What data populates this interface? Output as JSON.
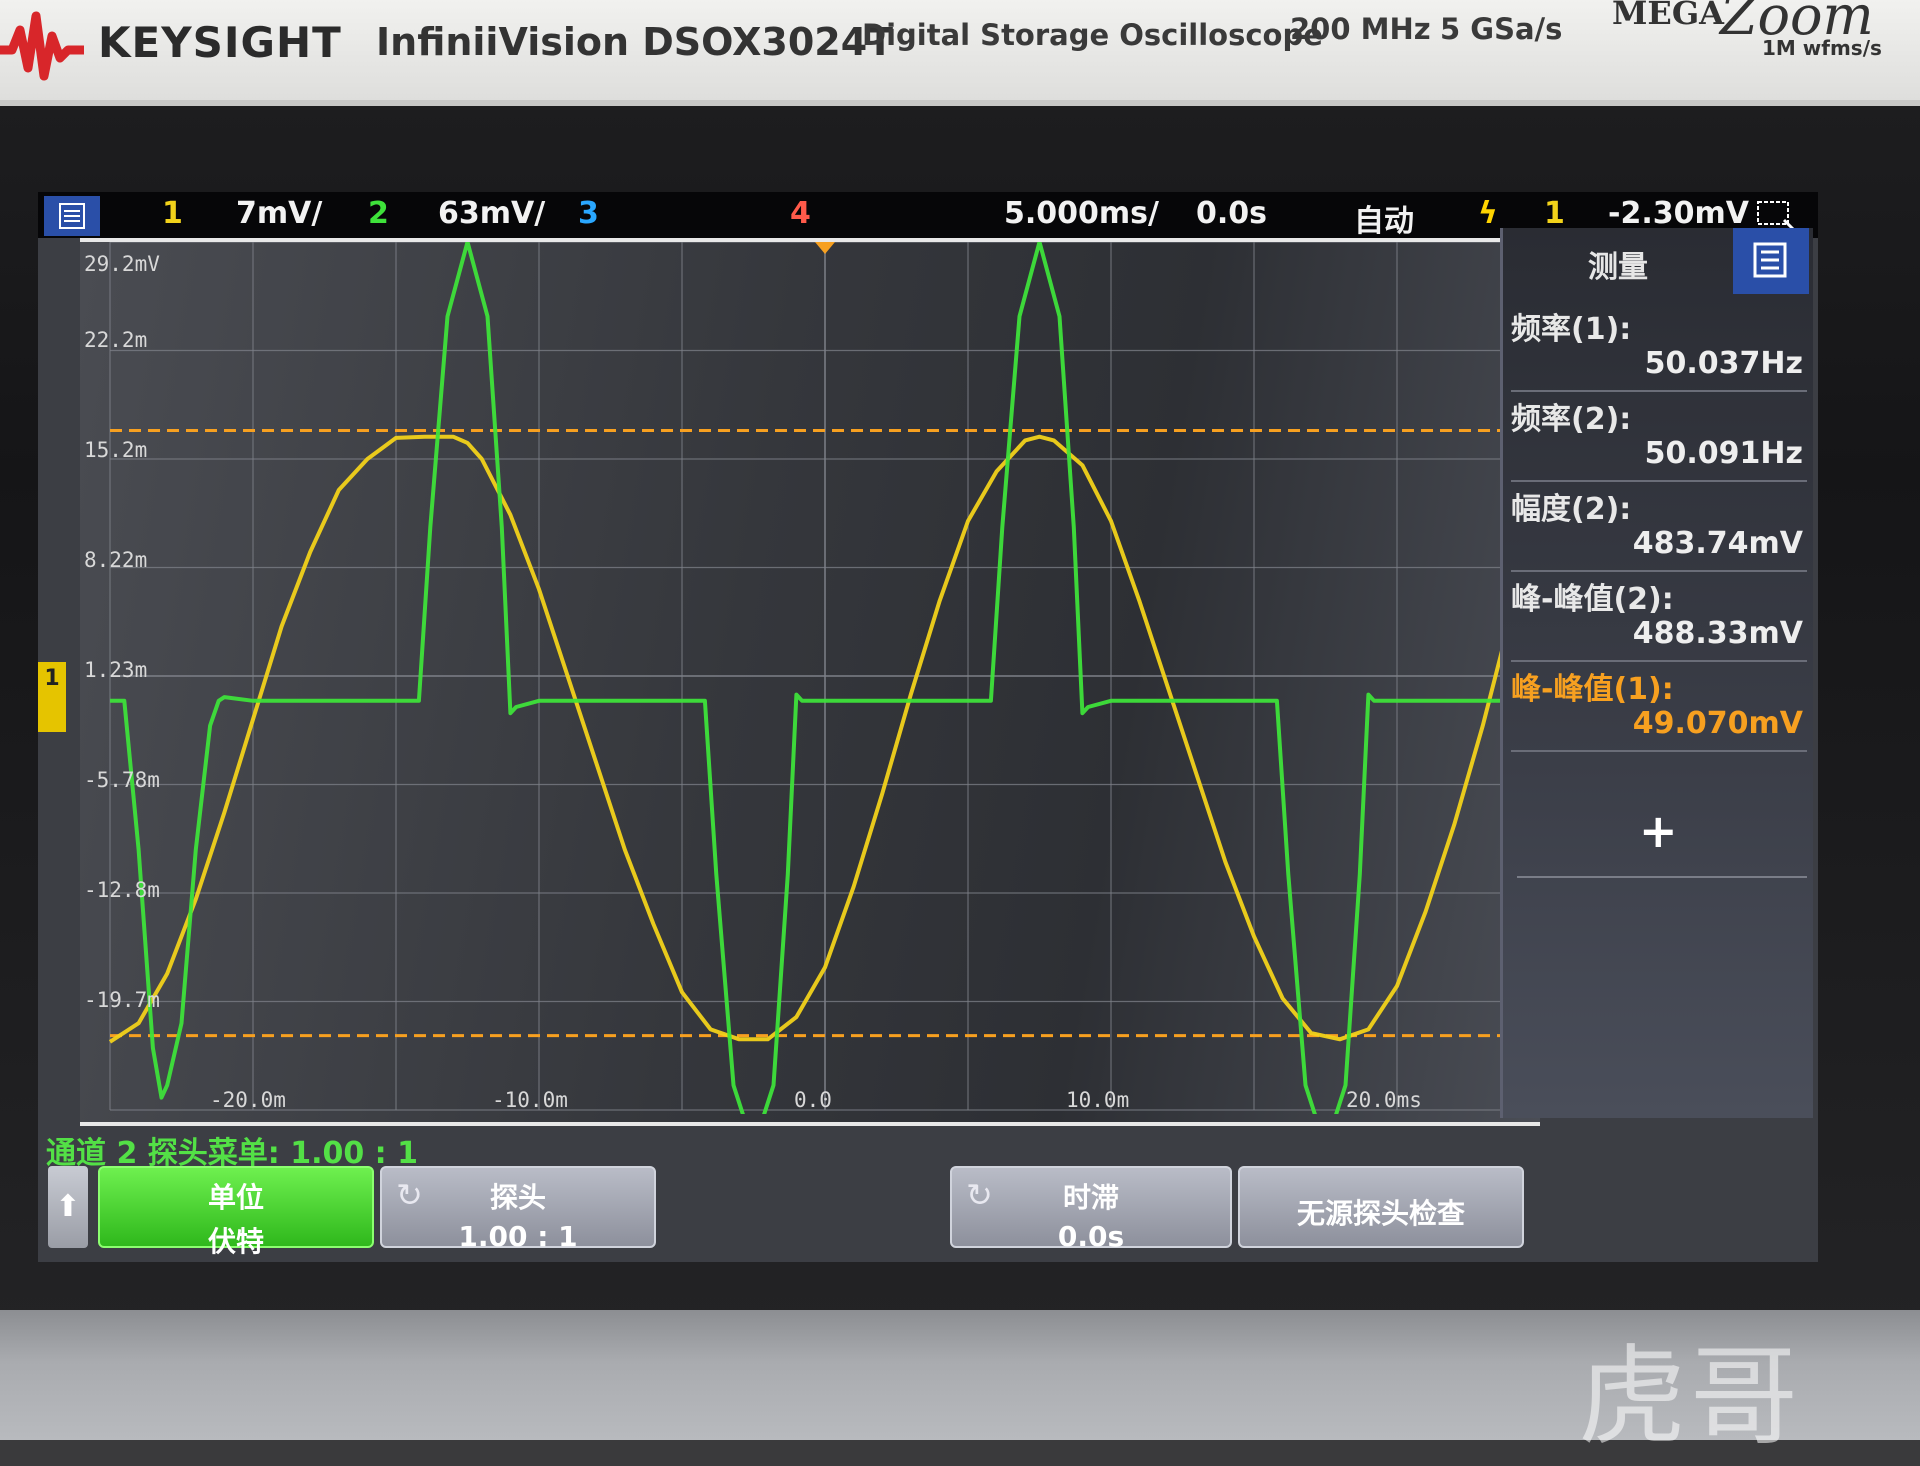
{
  "bezel": {
    "brand": "KEYSIGHT",
    "model": "InfiniiVision DSOX3024T",
    "description": "Digital Storage Oscilloscope",
    "bandwidth": "200 MHz",
    "sample_rate": "5 GSa/s",
    "megazoom_word": "MEGA",
    "megazoom_script": "Zoom",
    "megazoom_rate": "1M wfms/s",
    "watermark": "虎哥"
  },
  "status_bar": {
    "ch1_label": "1",
    "ch1_scale": "7mV/",
    "ch2_label": "2",
    "ch2_scale": "63mV/",
    "ch3_label": "3",
    "ch4_label": "4",
    "timebase": "5.000ms/",
    "delay": "0.0s",
    "trigger_mode": "自动",
    "trigger_source": "1",
    "trigger_level": "-2.30mV",
    "colors": {
      "ch1": "#f2d21a",
      "ch2": "#3ee23a",
      "ch3": "#2aa7ff",
      "ch4": "#ff5a4a",
      "trigger": "#ffd400"
    }
  },
  "measurements": {
    "title": "测量",
    "items": [
      {
        "label": "频率(1):",
        "value": "50.037Hz",
        "color": "#eeeeee"
      },
      {
        "label": "频率(2):",
        "value": "50.091Hz",
        "color": "#eeeeee"
      },
      {
        "label": "幅度(2):",
        "value": "483.74mV",
        "color": "#eeeeee"
      },
      {
        "label": "峰-峰值(2):",
        "value": "488.33mV",
        "color": "#eeeeee"
      },
      {
        "label": "峰-峰值(1):",
        "value": "49.070mV",
        "color": "#f7a020"
      }
    ],
    "add_label": "+"
  },
  "axes": {
    "y_ticks": [
      "29.2mV",
      "22.2m",
      "15.2m",
      "8.22m",
      "1.23m",
      "-5.78m",
      "-12.8m",
      "-19.7m"
    ],
    "x_ticks": [
      "-20.0m",
      "-10.0m",
      "0.0",
      "10.0m",
      "20.0ms"
    ],
    "channel_marker": "1"
  },
  "softkeys": {
    "menu_title": "通道 2 探头菜单: 1.00 : 1",
    "up_arrow": "⬆",
    "units_line1": "单位",
    "units_line2": "伏特",
    "probe_line1": "探头",
    "probe_line2": "1.00 : 1",
    "skew_line1": "时滞",
    "skew_line2": "0.0s",
    "passive_check": "无源探头检查",
    "cycle_icon": "↻"
  },
  "chart_data": {
    "type": "line",
    "x_unit": "ms",
    "y_unit": "mV",
    "xlim": [
      -25,
      25
    ],
    "ylim": [
      -33,
      37
    ],
    "series": [
      {
        "name": "1",
        "color": "#f2d21a",
        "frequency_hz": 50.037,
        "peak_to_peak_mV": 49.07,
        "x": [
          -25,
          -24,
          -23,
          -22,
          -21,
          -20,
          -19,
          -18,
          -17,
          -16,
          -15,
          -14,
          -13,
          -12.5,
          -12,
          -11,
          -10,
          -9,
          -8,
          -7,
          -6,
          -5,
          -4,
          -3,
          -2,
          -1,
          0,
          1,
          2,
          3,
          4,
          5,
          6,
          7,
          7.5,
          8,
          9,
          10,
          11,
          12,
          13,
          14,
          15,
          16,
          17,
          18,
          19,
          20,
          21,
          22,
          23,
          24,
          25
        ],
        "y": [
          -27.5,
          -26,
          -22,
          -16,
          -9,
          -1.5,
          6,
          12,
          17,
          19.5,
          21.2,
          21.3,
          21.3,
          20.8,
          19.5,
          15,
          9,
          2,
          -5,
          -12,
          -18,
          -23.5,
          -26.5,
          -27.3,
          -27.3,
          -25.5,
          -21.5,
          -15,
          -7.5,
          0.5,
          8,
          14.5,
          18.5,
          21,
          21.3,
          21,
          19,
          14.5,
          8,
          1,
          -6,
          -13,
          -19,
          -24,
          -26.8,
          -27.3,
          -26.5,
          -23,
          -17,
          -10,
          -2,
          7,
          14
        ]
      },
      {
        "name": "2",
        "color": "#3ee23a",
        "frequency_hz": 50.091,
        "peak_to_peak_mV": 488.33,
        "amplitude_mV": 483.74,
        "x": [
          -25,
          -24.5,
          -24,
          -23.5,
          -23.2,
          -23,
          -22.5,
          -22,
          -21.5,
          -21.2,
          -21,
          -20,
          -16,
          -14.2,
          -13.8,
          -13.2,
          -12.5,
          -11.8,
          -11.3,
          -11,
          -10.8,
          -10,
          -6,
          -4.2,
          -3.8,
          -3.2,
          -2.5,
          -1.8,
          -1.3,
          -1,
          -0.8,
          0,
          4,
          5.8,
          6.2,
          6.8,
          7.5,
          8.2,
          8.7,
          9,
          9.2,
          10,
          14,
          15.8,
          16.2,
          16.8,
          17.5,
          18.2,
          18.7,
          19,
          19.2,
          20,
          25
        ],
        "y": [
          0,
          0,
          -12,
          -28,
          -32,
          -31,
          -26,
          -12,
          -2,
          0,
          0.3,
          0,
          0,
          0,
          14,
          31,
          37,
          31,
          14,
          -1,
          -0.5,
          0,
          0,
          0,
          -14,
          -31,
          -36,
          -31,
          -14,
          0.5,
          0,
          0,
          0,
          0,
          14,
          31,
          37,
          31,
          14,
          -1,
          -0.5,
          0,
          0,
          0,
          -14,
          -31,
          -36,
          -31,
          -14,
          0.5,
          0,
          0,
          0
        ]
      }
    ],
    "trigger_level_mV": -2.3,
    "cursor_levels_mV": [
      21.8,
      -27.0
    ]
  }
}
